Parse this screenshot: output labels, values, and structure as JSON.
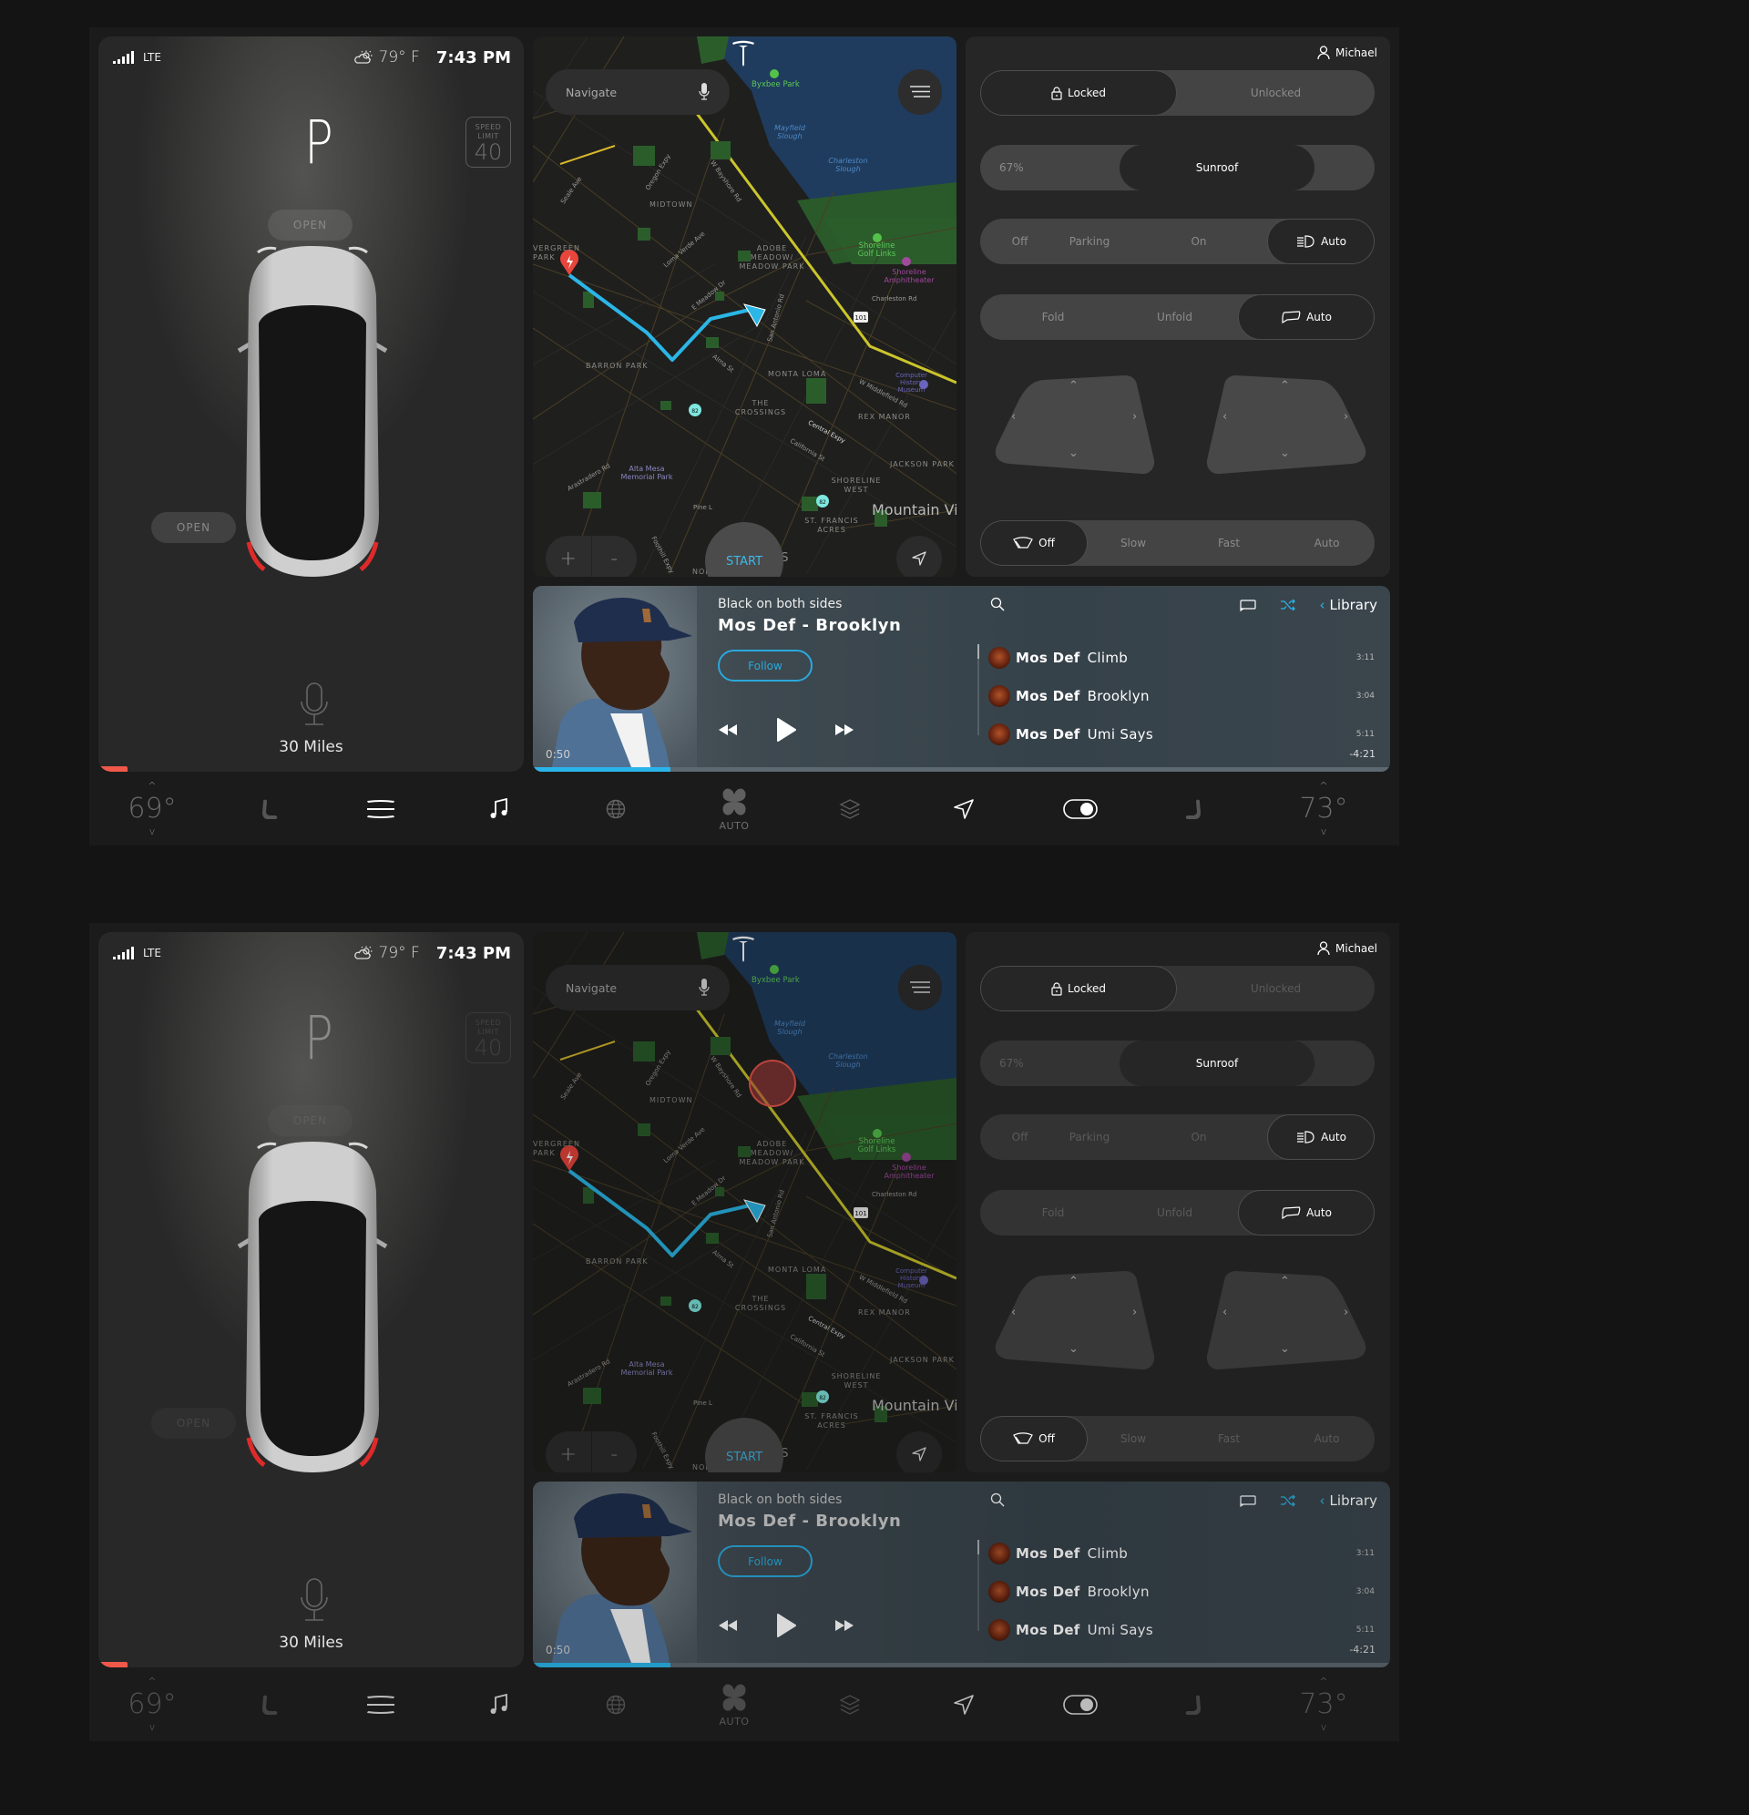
{
  "screens": [
    {
      "variant": "active",
      "status": {
        "network": "LTE",
        "weather_icon": "partly-cloudy-icon",
        "temperature": "79° F",
        "time": "7:43 PM"
      },
      "drive": {
        "gear": "P",
        "speed_limit_label": "SPEED LIMIT",
        "speed_limit_line1": "SPEED",
        "speed_limit_line2": "LIMIT",
        "speed_limit": "40",
        "frunk_label": "OPEN",
        "trunk_label": "OPEN",
        "range": "30 Miles",
        "battery_level_pct": 7
      },
      "map": {
        "search_placeholder": "Navigate",
        "start_label": "START",
        "zoom_in_label": "+",
        "zoom_out_label": "-",
        "touch_indicator": false,
        "labels": {
          "byxbee": "Byxbee Park",
          "mayfield": "Mayfield Slough",
          "charleston_slough": "Charleston Slough",
          "midtown": "MIDTOWN",
          "evergreen": "VERGREEN PARK",
          "adobe": "ADOBE MEADOW/ MEADOW PARK",
          "shoreline_golf": "Shoreline Golf Links",
          "shoreline_amph": "Shoreline Amphitheater",
          "barron": "BARRON PARK",
          "monta_loma": "MONTA LOMA",
          "crossings": "THE CROSSINGS",
          "rex_manor": "REX MANOR",
          "alta_mesa": "Alta Mesa Memorial Park",
          "shoreline_west": "SHORELINE WEST",
          "jackson": "JACKSON PARK",
          "st_francis": "ST. FRANCIS ACRES",
          "mountain_view": "Mountain Vie",
          "north_los": "NORTH LOS",
          "charleston_rd": "Charleston Rd",
          "computer_history": "Computer History Museum",
          "central": "Central Expy",
          "california": "California St",
          "alma": "Alma St",
          "middlefield": "W Middlefield Rd",
          "arastradero": "Arastradero Rd",
          "foothill": "Foothill Expy",
          "oregon": "Oregon Expy",
          "bayshore": "W Bayshore Rd",
          "loma_verde": "Loma Verde Ave",
          "e_meadow": "E Meadow Dr",
          "san_antonio": "San Antonio Rd",
          "seale": "Seale Ave",
          "pine": "Pine L",
          "hwy101": "101",
          "hwy82a": "82",
          "hwy82b": "82",
          "los": "OS"
        }
      },
      "controls": {
        "user": "Michael",
        "lock": {
          "options": [
            "Locked",
            "Unlocked"
          ],
          "selected": "Locked"
        },
        "sunroof": {
          "value": "67%",
          "label": "Sunroof"
        },
        "lights": {
          "options": [
            "Off",
            "Parking",
            "On",
            "Auto"
          ],
          "selected": "Auto"
        },
        "mirrors": {
          "options": [
            "Fold",
            "Unfold",
            "Auto"
          ],
          "selected": "Auto"
        },
        "wipers": {
          "options": [
            "Off",
            "Slow",
            "Fast",
            "Auto"
          ],
          "selected": "Off"
        },
        "mirror_arrows": {
          "up": "⌃",
          "down": "⌄",
          "left": "‹",
          "right": "›"
        }
      },
      "music": {
        "album": "Black on both sides",
        "now_playing": "Mos Def - Brooklyn",
        "follow_label": "Follow",
        "elapsed": "0:50",
        "remaining": "-4:21",
        "progress_pct": 16,
        "library_label": "Library",
        "tracks": [
          {
            "artist": "Mos Def",
            "title": "Climb",
            "duration": "3:11"
          },
          {
            "artist": "Mos Def",
            "title": "Brooklyn",
            "duration": "3:04"
          },
          {
            "artist": "Mos Def",
            "title": "Umi Says",
            "duration": "5:11"
          }
        ]
      },
      "bottombar": {
        "driver_temp": "69°",
        "passenger_temp": "73°",
        "fan_label": "AUTO",
        "accent": "#2ab5ea"
      }
    },
    {
      "variant": "dimmed",
      "status": {
        "network": "LTE",
        "weather_icon": "partly-cloudy-icon",
        "temperature": "79° F",
        "time": "7:43 PM"
      },
      "drive": {
        "gear": "P",
        "speed_limit_line1": "SPEED",
        "speed_limit_line2": "LIMIT",
        "speed_limit": "40",
        "frunk_label": "OPEN",
        "trunk_label": "OPEN",
        "range": "30 Miles",
        "battery_level_pct": 7
      },
      "map": {
        "search_placeholder": "Navigate",
        "start_label": "START",
        "zoom_in_label": "+",
        "zoom_out_label": "-",
        "touch_indicator": true
      },
      "controls": {
        "user": "Michael",
        "lock": {
          "options": [
            "Locked",
            "Unlocked"
          ],
          "selected": "Locked"
        },
        "sunroof": {
          "value": "67%",
          "label": "Sunroof"
        },
        "lights": {
          "options": [
            "Off",
            "Parking",
            "On",
            "Auto"
          ],
          "selected": "Auto"
        },
        "mirrors": {
          "options": [
            "Fold",
            "Unfold",
            "Auto"
          ],
          "selected": "Auto"
        },
        "wipers": {
          "options": [
            "Off",
            "Slow",
            "Fast",
            "Auto"
          ],
          "selected": "Off"
        }
      },
      "music": {
        "album": "Black on both sides",
        "now_playing": "Mos Def - Brooklyn",
        "follow_label": "Follow",
        "elapsed": "0:50",
        "remaining": "-4:21",
        "progress_pct": 16,
        "library_label": "Library",
        "tracks": [
          {
            "artist": "Mos Def",
            "title": "Climb",
            "duration": "3:11"
          },
          {
            "artist": "Mos Def",
            "title": "Brooklyn",
            "duration": "3:04"
          },
          {
            "artist": "Mos Def",
            "title": "Umi Says",
            "duration": "5:11"
          }
        ]
      },
      "bottombar": {
        "driver_temp": "69°",
        "passenger_temp": "73°",
        "fan_label": "AUTO"
      }
    }
  ]
}
